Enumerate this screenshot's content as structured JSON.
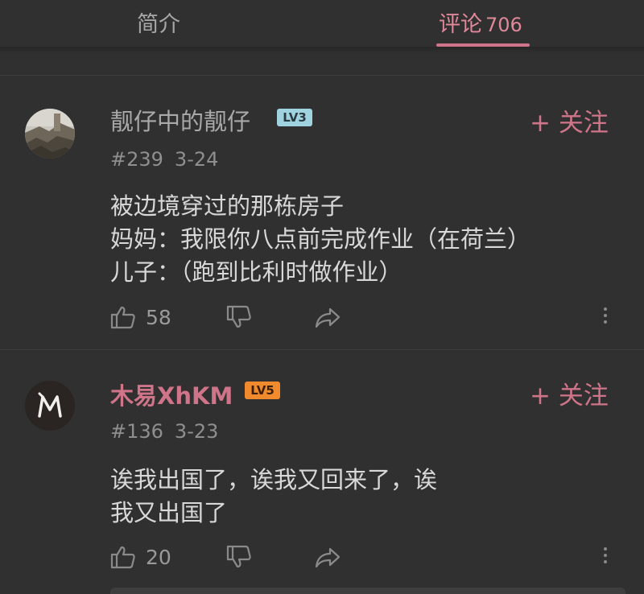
{
  "tabs": {
    "intro": "简介",
    "comments": "评论",
    "comments_count": "706"
  },
  "comments": [
    {
      "username": "靓仔中的靓仔",
      "level": "LV3",
      "follow": "+ 关注",
      "floor": "#239",
      "date": "3-24",
      "lines": [
        "被边境穿过的那栋房子",
        "妈妈：我限你八点前完成作业（在荷兰）",
        "儿子：（跑到比利时做作业）"
      ],
      "likes": "58"
    },
    {
      "username": "木易XhKM",
      "level": "LV5",
      "follow": "+ 关注",
      "floor": "#136",
      "date": "3-23",
      "lines": [
        "诶我出国了，诶我又回来了，诶",
        "我又出国了"
      ],
      "likes": "20"
    }
  ],
  "colors": {
    "accent": "#d0748a",
    "background": "#303030",
    "level3": "#9fd3e0",
    "level5": "#f08a2d"
  }
}
